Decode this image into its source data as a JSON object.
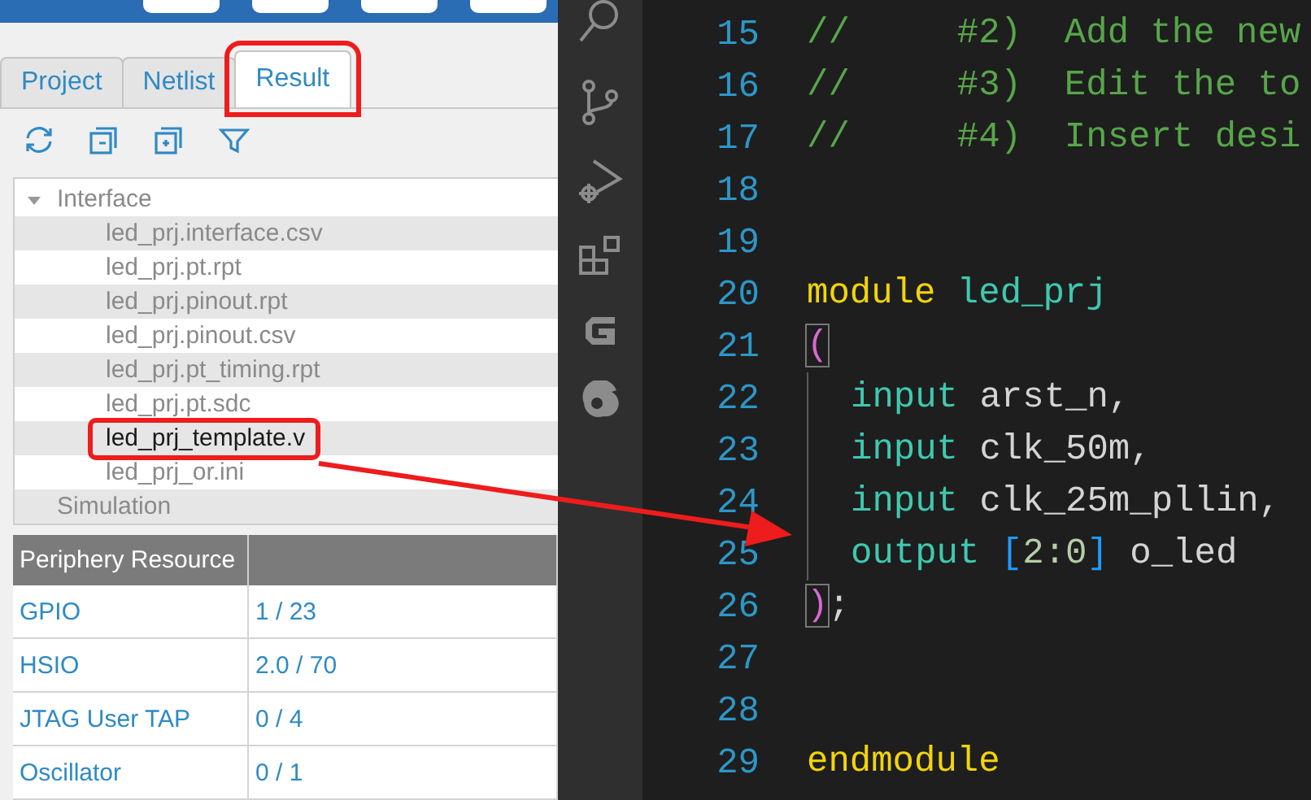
{
  "left_panel": {
    "tabs": [
      {
        "label": "Project",
        "selected": false,
        "highlighted": false
      },
      {
        "label": "Netlist",
        "selected": false,
        "highlighted": false
      },
      {
        "label": "Result",
        "selected": true,
        "highlighted": true
      }
    ],
    "tree": [
      {
        "label": "Interface",
        "expanded": true,
        "children": [
          {
            "label": "led_prj.interface.csv",
            "selected": false,
            "highlighted": false
          },
          {
            "label": "led_prj.pt.rpt",
            "selected": false,
            "highlighted": false
          },
          {
            "label": "led_prj.pinout.rpt",
            "selected": false,
            "highlighted": false
          },
          {
            "label": "led_prj.pinout.csv",
            "selected": false,
            "highlighted": false
          },
          {
            "label": "led_prj.pt_timing.rpt",
            "selected": false,
            "highlighted": false
          },
          {
            "label": "led_prj.pt.sdc",
            "selected": false,
            "highlighted": false
          },
          {
            "label": "led_prj_template.v",
            "selected": true,
            "highlighted": true
          },
          {
            "label": "led_prj_or.ini",
            "selected": false,
            "highlighted": false
          }
        ]
      },
      {
        "label": "Simulation"
      }
    ],
    "table": {
      "columns": [
        "Periphery Resource"
      ],
      "rows": [
        [
          "GPIO",
          "1 / 23"
        ],
        [
          "HSIO",
          "2.0 / 70"
        ],
        [
          "JTAG User TAP",
          "0 / 4"
        ],
        [
          "Oscillator",
          "0 / 1"
        ]
      ]
    }
  },
  "editor": {
    "lines": [
      {
        "number": "15",
        "tokens": [
          {
            "kind": "comment",
            "text": "//     #2)  Add the new"
          }
        ]
      },
      {
        "number": "16",
        "tokens": [
          {
            "kind": "comment",
            "text": "//     #3)  Edit the to"
          }
        ]
      },
      {
        "number": "17",
        "tokens": [
          {
            "kind": "comment",
            "text": "//     #4)  Insert desi"
          }
        ]
      },
      {
        "number": "18"
      },
      {
        "number": "19"
      },
      {
        "number": "20",
        "tokens": [
          {
            "kind": "keyword",
            "text": "module "
          },
          {
            "kind": "type",
            "text": "led_prj"
          }
        ]
      },
      {
        "number": "21",
        "tokens": [
          {
            "kind": "paren",
            "text": "("
          }
        ]
      },
      {
        "number": "22",
        "indented": true,
        "tokens": [
          {
            "kind": "type",
            "text": "input "
          },
          {
            "kind": "ident",
            "text": "arst_n,"
          }
        ]
      },
      {
        "number": "23",
        "indented": true,
        "tokens": [
          {
            "kind": "type",
            "text": "input "
          },
          {
            "kind": "ident",
            "text": "clk_50m,"
          }
        ]
      },
      {
        "number": "24",
        "indented": true,
        "tokens": [
          {
            "kind": "type",
            "text": "input "
          },
          {
            "kind": "ident",
            "text": "clk_25m_pllin,"
          }
        ]
      },
      {
        "number": "25",
        "indented": true,
        "tokens": [
          {
            "kind": "type",
            "text": "output "
          },
          {
            "kind": "bracket",
            "text": "["
          },
          {
            "kind": "number",
            "text": "2:0"
          },
          {
            "kind": "bracket",
            "text": "] "
          },
          {
            "kind": "ident",
            "text": "o_led"
          }
        ]
      },
      {
        "number": "26",
        "tokens": [
          {
            "kind": "paren",
            "text": ")"
          },
          {
            "kind": "ident",
            "text": ";"
          }
        ]
      },
      {
        "number": "27"
      },
      {
        "number": "28"
      },
      {
        "number": "29",
        "tokens": [
          {
            "kind": "keyword",
            "text": "endmodule"
          }
        ]
      }
    ]
  }
}
